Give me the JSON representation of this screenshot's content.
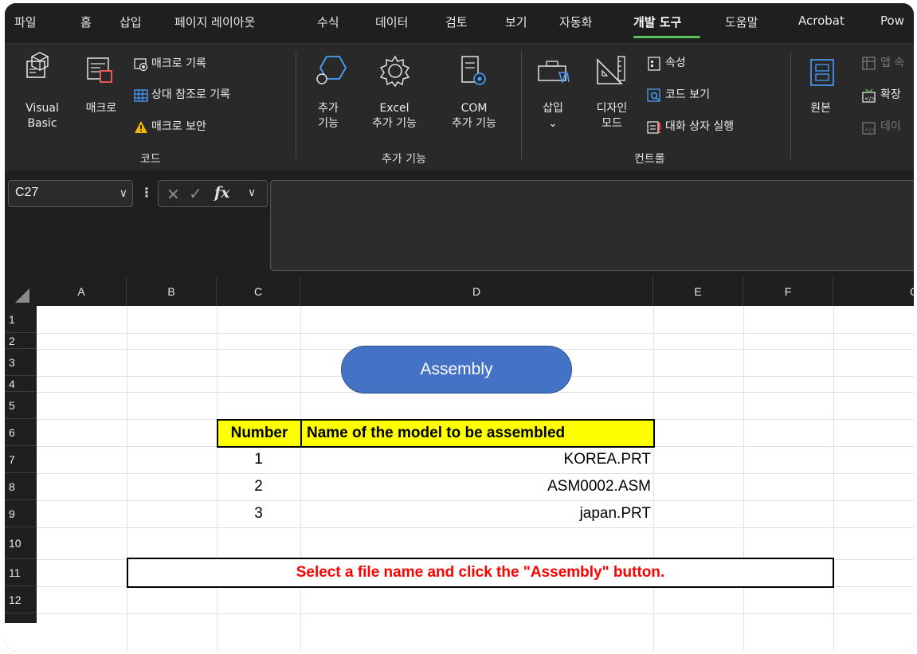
{
  "tabs": [
    "파일",
    "홈",
    "삽입",
    "페이지 레이아웃",
    "수식",
    "데이터",
    "검토",
    "보기",
    "자동화",
    "개발 도구",
    "도움말",
    "Acrobat",
    "Pow"
  ],
  "active_tab": "개발 도구",
  "ribbon": {
    "code": {
      "visual_basic_1": "Visual",
      "visual_basic_2": "Basic",
      "macro": "매크로",
      "record_macro": "매크로 기록",
      "relative_ref": "상대 참조로 기록",
      "macro_security": "매크로 보안",
      "group_label": "코드"
    },
    "addins": {
      "addins_1": "추가",
      "addins_2": "기능",
      "excel_addins_1": "Excel",
      "excel_addins_2": "추가 기능",
      "com_addins_1": "COM",
      "com_addins_2": "추가 기능",
      "group_label": "추가 기능"
    },
    "controls": {
      "insert": "삽입",
      "design_mode_1": "디자인",
      "design_mode_2": "모드",
      "properties": "속성",
      "view_code": "코드 보기",
      "run_dialog": "대화 상자 실행",
      "group_label": "컨트롤"
    },
    "xml": {
      "source": "원본",
      "map_props": "맵 속",
      "expansion": "확장",
      "data": "데이"
    }
  },
  "formula_bar": {
    "name_box": "C27",
    "formula": ""
  },
  "columns": [
    "A",
    "B",
    "C",
    "D",
    "E",
    "F",
    "G"
  ],
  "rows": [
    "1",
    "2",
    "3",
    "4",
    "5",
    "6",
    "7",
    "8",
    "9",
    "10",
    "11",
    "12"
  ],
  "sheet": {
    "button_label": "Assembly",
    "table_header_number": "Number",
    "table_header_name": "Name of the model to be assembled",
    "table_rows": [
      {
        "number": "1",
        "name": "KOREA.PRT"
      },
      {
        "number": "2",
        "name": "ASM0002.ASM"
      },
      {
        "number": "3",
        "name": "japan.PRT"
      }
    ],
    "instruction": "Select a file name and click the \"Assembly\" button."
  },
  "colors": {
    "button": "#4472c4",
    "header_fill": "#ffff00",
    "instruction_text": "#ff0000",
    "active_tab_underline": "#5cc15c"
  }
}
